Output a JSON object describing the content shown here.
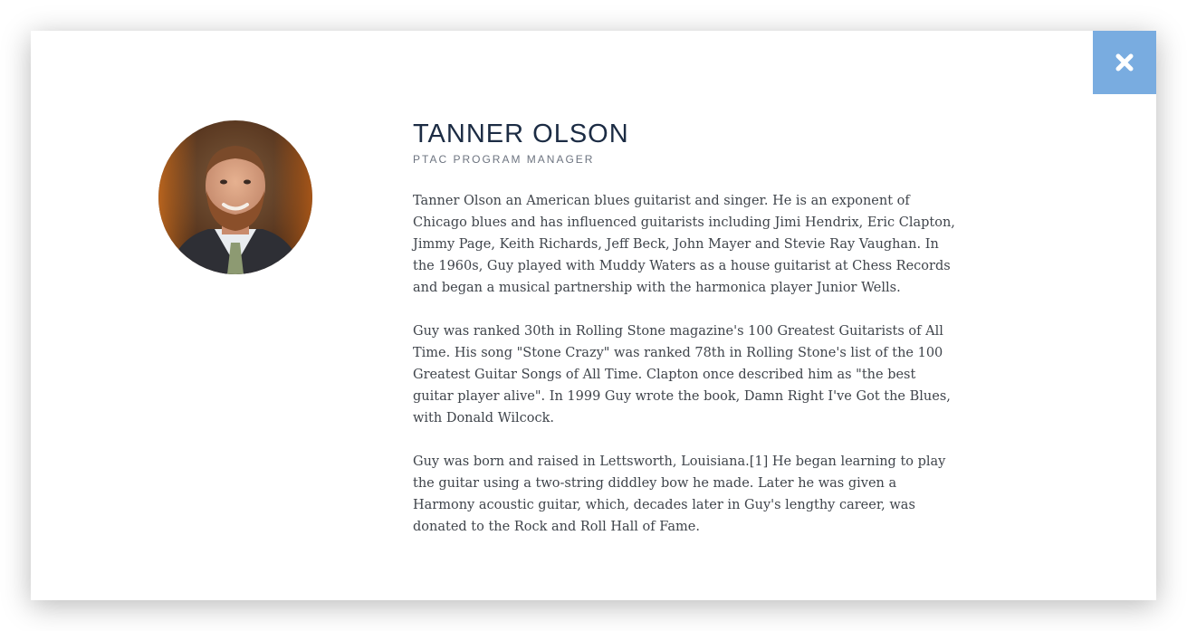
{
  "modal": {
    "close_icon": "close-icon",
    "close_color": "#79ace0"
  },
  "profile": {
    "photo_alt": "Portrait photo of Tanner Olson",
    "name": "TANNER OLSON",
    "title": "PTAC PROGRAM MANAGER",
    "bio": [
      "Tanner Olson an American blues guitarist and singer. He is an exponent of Chicago blues and has influenced guitarists including Jimi Hendrix, Eric Clapton, Jimmy Page, Keith Richards, Jeff Beck, John Mayer and Stevie Ray Vaughan. In the 1960s, Guy played with Muddy Waters as a house guitarist at Chess Records and began a musical partnership with the harmonica player Junior Wells.",
      "Guy was ranked 30th in Rolling Stone magazine's 100 Greatest Guitarists of All Time. His song \"Stone Crazy\" was ranked 78th in Rolling Stone's list of the 100 Greatest Guitar Songs of All Time. Clapton once described him as \"the best guitar player alive\". In 1999 Guy wrote the book, Damn Right I've Got the Blues, with Donald Wilcock.",
      "Guy was born and raised in Lettsworth, Louisiana.[1] He began learning to play the guitar using a two-string diddley bow he made. Later he was given a Harmony acoustic guitar, which, decades later in Guy's lengthy career, was donated to the Rock and Roll Hall of Fame."
    ]
  }
}
